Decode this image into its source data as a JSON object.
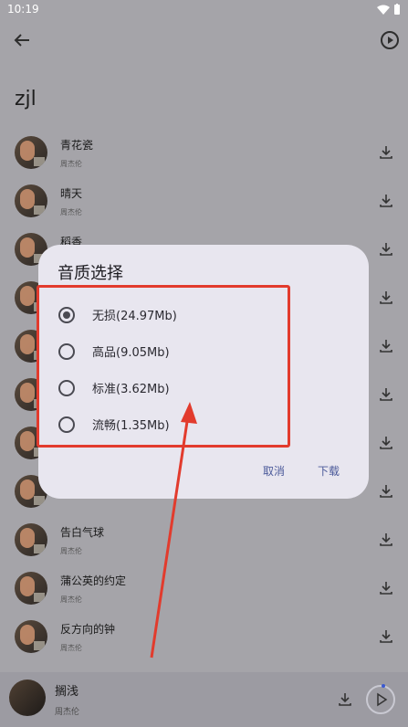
{
  "status": {
    "time": "10:19"
  },
  "header": {
    "title": "zjl"
  },
  "songs": [
    {
      "title": "青花瓷",
      "artist": "周杰伦"
    },
    {
      "title": "晴天",
      "artist": "周杰伦"
    },
    {
      "title": "稻香",
      "artist": ""
    },
    {
      "title": "",
      "artist": ""
    },
    {
      "title": "",
      "artist": ""
    },
    {
      "title": "",
      "artist": ""
    },
    {
      "title": "",
      "artist": ""
    },
    {
      "title": "",
      "artist": ""
    },
    {
      "title": "告白气球",
      "artist": "周杰伦"
    },
    {
      "title": "蒲公英的约定",
      "artist": "周杰伦"
    },
    {
      "title": "反方向的钟",
      "artist": "周杰伦"
    }
  ],
  "now_playing": {
    "title": "搁浅",
    "artist": "周杰伦"
  },
  "dialog": {
    "title": "音质选择",
    "options": [
      {
        "label": "无损(24.97Mb)",
        "selected": true
      },
      {
        "label": "高品(9.05Mb)",
        "selected": false
      },
      {
        "label": "标准(3.62Mb)",
        "selected": false
      },
      {
        "label": "流畅(1.35Mb)",
        "selected": false
      }
    ],
    "cancel": "取消",
    "confirm": "下载"
  },
  "colors": {
    "accent": "#4b5a9a",
    "annotation": "#e23b2d"
  }
}
